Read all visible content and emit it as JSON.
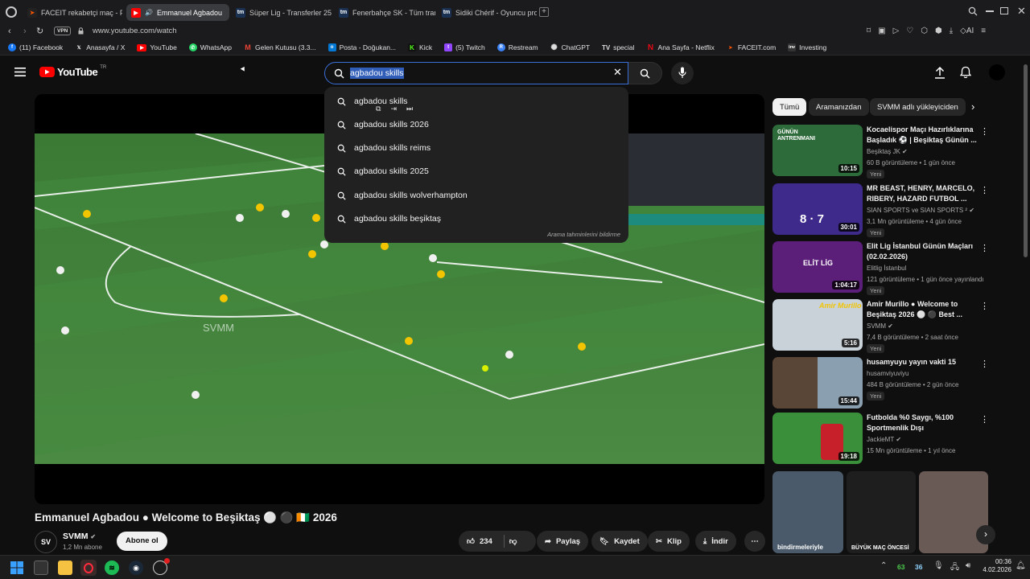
{
  "browser": {
    "tabs": [
      {
        "label": "FACEIT rekabetçi maç - FA",
        "icon": "faceit-icon",
        "active": false
      },
      {
        "label": "Emmanuel Agbadou",
        "icon": "youtube-icon",
        "active": true
      },
      {
        "label": "Süper Lig - Transferler 25",
        "icon": "tm-icon",
        "active": false
      },
      {
        "label": "Fenerbahçe SK - Tüm tran",
        "icon": "tm-icon",
        "active": false
      },
      {
        "label": "Sidiki Chérif - Oyuncu prof",
        "icon": "tm-icon",
        "active": false
      }
    ],
    "vpn_label": "VPN",
    "url": "www.youtube.com/watch",
    "bookmarks": [
      {
        "label": "(11) Facebook",
        "icon": "facebook-icon",
        "color": "#1877f2"
      },
      {
        "label": "Anasayfa / X",
        "icon": "x-icon",
        "color": "#000000"
      },
      {
        "label": "YouTube",
        "icon": "youtube-icon",
        "color": "#ff0000"
      },
      {
        "label": "WhatsApp",
        "icon": "whatsapp-icon",
        "color": "#25d366"
      },
      {
        "label": "Gelen Kutusu (3.3...",
        "icon": "gmail-icon",
        "color": "#ea4335"
      },
      {
        "label": "Posta - Doğukan...",
        "icon": "outlook-icon",
        "color": "#0078d4"
      },
      {
        "label": "Kick",
        "icon": "kick-icon",
        "color": "#53fc18"
      },
      {
        "label": "(5) Twitch",
        "icon": "twitch-icon",
        "color": "#9146ff"
      },
      {
        "label": "Restream",
        "icon": "restream-icon",
        "color": "#3b82f6"
      },
      {
        "label": "ChatGPT",
        "icon": "chatgpt-icon",
        "color": "#10a37f"
      },
      {
        "label": "special",
        "icon": "tradingview-icon",
        "color": "#dddddd"
      },
      {
        "label": "Ana Sayfa - Netflix",
        "icon": "netflix-icon",
        "color": "#e50914"
      },
      {
        "label": "FACEIT.com",
        "icon": "faceit-icon",
        "color": "#ff5500"
      },
      {
        "label": "Investing",
        "icon": "investing-icon",
        "color": "#333333"
      }
    ]
  },
  "youtube": {
    "logo_text": "YouTube",
    "logo_region": "TR",
    "search_value": "agbadou skills",
    "suggestions": [
      "agbadou skills",
      "agbadou skills 2026",
      "agbadou skills reims",
      "agbadou skills 2025",
      "agbadou skills wolverhampton",
      "agbadou skills beşiktaş"
    ],
    "report_label": "Arama tahminlerini bildirme",
    "video_watermark": "SVMM",
    "video_title": "Emmanuel Agbadou ● Welcome to Beşiktaş ⚪ ⚫ 🇨🇮 2026",
    "channel": {
      "name": "SVMM",
      "subscribers": "1,2 Mn abone",
      "avatar_text": "SV"
    },
    "subscribe_label": "Abone ol",
    "actions": {
      "likes": "234",
      "share": "Paylaş",
      "save": "Kaydet",
      "clip": "Klip",
      "download": "İndir"
    },
    "chips": [
      "Tümü",
      "Aramanızdan",
      "SVMM adlı yükleyiciden"
    ],
    "related": [
      {
        "title": "Kocaelispor Maçı Hazırlıklarına Başladık ⚽ | Beşiktaş Günün ...",
        "channel": "Beşiktaş JK",
        "verified": true,
        "meta": "60 B görüntüleme • 1 gün önce",
        "badge": "Yeni",
        "duration": "10:15",
        "thumb_color": "#2e6b3a",
        "thumb_text": "GÜNÜN ANTRENMANI"
      },
      {
        "title": "MR BEAST, HENRY, MARCELO, RIBERY, HAZARD FUTBOL ...",
        "channel": "SIAN SPORTS ve SIAN SPORTS ²",
        "verified": true,
        "meta": "3,1 Mn görüntüleme • 4 gün önce",
        "badge": "Yeni",
        "duration": "30:01",
        "thumb_color": "#3d2a8a",
        "thumb_text": "8 · 7"
      },
      {
        "title": "Elit Lig İstanbul Günün Maçları (02.02.2026)",
        "channel": "Elitlig İstanbul",
        "verified": false,
        "meta": "121 görüntüleme • 1 gün önce yayınlandı",
        "badge": "Yeni",
        "duration": "1:04:17",
        "thumb_color": "#5b1f7a",
        "thumb_text": "ELİT LİG"
      },
      {
        "title": "Amir Murillo ● Welcome to Beşiktaş 2026 ⚪ ⚫ Best ...",
        "channel": "SVMM",
        "verified": true,
        "meta": "7,4 B görüntüleme • 2 saat önce",
        "badge": "Yeni",
        "duration": "5:16",
        "thumb_color": "#c9d1d9",
        "thumb_text": "Amir Murillo"
      },
      {
        "title": "husamyuyu yayın vakti 15",
        "channel": "husamviyuviyu",
        "verified": false,
        "meta": "484 B görüntüleme • 2 gün önce",
        "badge": "Yeni",
        "duration": "15:44",
        "thumb_color": "#5a4636",
        "thumb_text": ""
      },
      {
        "title": "Futbolda %0 Saygı, %100 Sportmenlik Dışı",
        "channel": "JackieMT",
        "verified": true,
        "meta": "15 Mn görüntüleme • 1 yıl önce",
        "badge": "",
        "duration": "19:18",
        "thumb_color": "#3a8f3a",
        "thumb_text": ""
      }
    ],
    "shorts": [
      {
        "caption": "bindirmeleriyle",
        "color": "#4a5a6a"
      },
      {
        "caption": "BÜYÜK MAÇ ÖNCESİ",
        "color": "#1e1e1e"
      },
      {
        "caption": "",
        "color": "#6a5a55"
      }
    ]
  },
  "taskbar": {
    "tray_left": "63",
    "tray_right": "36",
    "time": "00:36",
    "date": "4.02.2026"
  }
}
